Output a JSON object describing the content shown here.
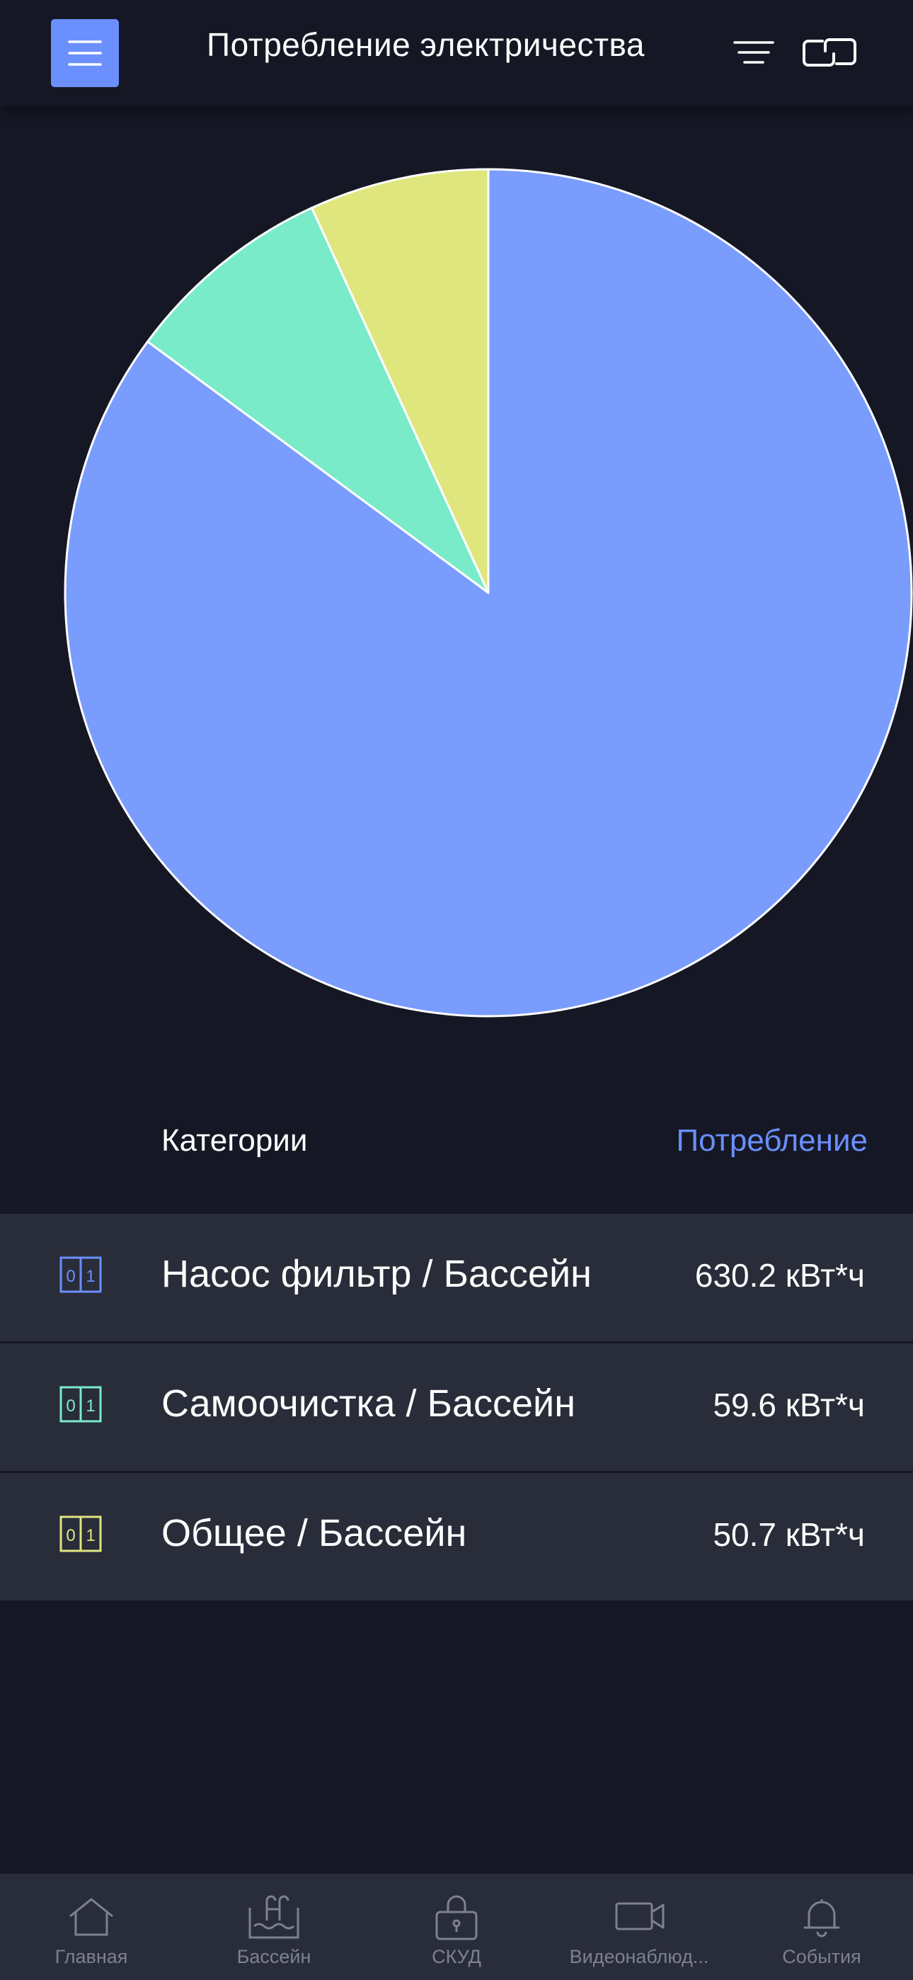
{
  "header": {
    "title": "Потребление электричества",
    "menu_icon": "hamburger-icon",
    "filter_icon": "filter-icon",
    "link_icon": "link-icon"
  },
  "colors": {
    "background": "#151824",
    "accent": "#6b8ffd",
    "row_background": "#292c39"
  },
  "chart_data": {
    "type": "pie",
    "labels": [
      "Насос фильтр / Бассейн",
      "Самоочистка / Бассейн",
      "Общее / Бассейн"
    ],
    "values": [
      630.2,
      59.6,
      50.7
    ],
    "colors": [
      "#7a9cfd",
      "#7aebc9",
      "#dfe67e"
    ],
    "unit": "кВт*ч"
  },
  "list": {
    "header_categories": "Категории",
    "header_consumption": "Потребление",
    "rows": [
      {
        "name": "Насос фильтр / Бассейн",
        "value": "630.2 кВт*ч",
        "icon": "counter-icon",
        "color": "#6b8ffd"
      },
      {
        "name": "Самоочистка / Бассейн",
        "value": "59.6 кВт*ч",
        "icon": "counter-icon",
        "color": "#7aebc9"
      },
      {
        "name": "Общее / Бассейн",
        "value": "50.7 кВт*ч",
        "icon": "counter-icon",
        "color": "#dfe67e"
      }
    ]
  },
  "nav": {
    "items": [
      {
        "label": "Главная",
        "icon": "home-icon"
      },
      {
        "label": "Бассейн",
        "icon": "pool-icon"
      },
      {
        "label": "СКУД",
        "icon": "lock-icon"
      },
      {
        "label": "Видеонаблюд...",
        "icon": "video-camera-icon"
      },
      {
        "label": "События",
        "icon": "bell-icon"
      }
    ]
  }
}
